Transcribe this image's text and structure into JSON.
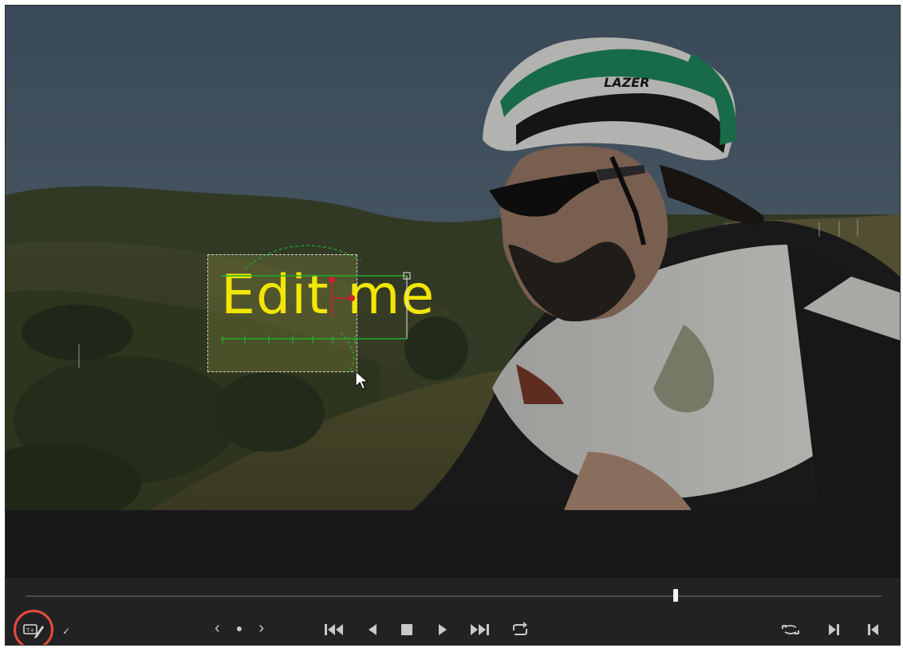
{
  "viewer": {
    "title_text": "Edit me",
    "helmet_brand": "LAZER"
  },
  "transport": {
    "playhead_position": 0.76,
    "controls": {
      "prev_keyframe": "‹",
      "keyframe": "●",
      "next_keyframe": "›",
      "edit_tool_dropdown": "✓"
    }
  },
  "colors": {
    "title_text": "#f2e600",
    "highlight_ring": "#e74c3c",
    "transport_bg": "#222224",
    "viewer_bg": "#18181a"
  },
  "icons": [
    "text-edit-tool-icon",
    "jump-to-start-icon",
    "play-reverse-icon",
    "stop-icon",
    "play-icon",
    "jump-to-end-icon",
    "loop-icon",
    "match-frame-icon",
    "mark-in-icon",
    "mark-out-icon"
  ]
}
